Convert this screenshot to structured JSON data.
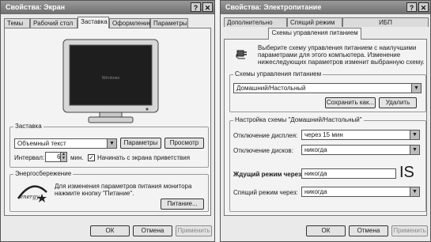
{
  "left_dialog": {
    "title": "Свойства: Экран",
    "help_button": "?",
    "close_button": "✕",
    "tabs": [
      "Темы",
      "Рабочий стол",
      "Заставка",
      "Оформление",
      "Параметры"
    ],
    "screensaver_group": "Заставка",
    "screensaver_value": "Объемный текст",
    "params_button": "Параметры",
    "preview_button": "Просмотр",
    "interval_label": "Интервал:",
    "interval_value": "6",
    "minutes_label": "мин.",
    "welcome_checkbox_label": "Начинать с экрана приветствия",
    "welcome_checked": true,
    "energy_group": "Энергосбережение",
    "energy_text_line1": "Для изменения параметров питания монитора",
    "energy_text_line2": "нажмите кнопку \"Питание\".",
    "power_button": "Питание...",
    "ok_button": "ОК",
    "cancel_button": "Отмена",
    "apply_button": "Применить"
  },
  "right_dialog": {
    "title": "Свойства: Электропитание",
    "help_button": "?",
    "close_button": "✕",
    "tabs_row_back": [
      "Дополнительно",
      "Спящий режим",
      "ИБП"
    ],
    "tab_active": "Схемы управления питанием",
    "description_line1": "Выберите схему управления питанием с наилучшими",
    "description_line2": "параметрами для этого компьютера. Изменение",
    "description_line3": "нижеследующих параметров изменит выбранную схему.",
    "schemes_group": "Схемы управления питанием",
    "scheme_value": "Домашний/Настольный",
    "save_as_button": "Сохранить как...",
    "delete_button": "Удалить",
    "settings_group": "Настройка схемы \"Домашний/Настольный\"",
    "rows": [
      {
        "label": "Отключение дисплея:",
        "value": "через 15 мин"
      },
      {
        "label": "Отключение дисков:",
        "value": "никогда"
      },
      {
        "label": "Ждущий режим через:",
        "value": "никогда"
      },
      {
        "label": "Спящий режим через:",
        "value": "никогда"
      }
    ],
    "side_mark": "IS",
    "ok_button": "ОК",
    "cancel_button": "Отмена",
    "apply_button": "Применить"
  }
}
